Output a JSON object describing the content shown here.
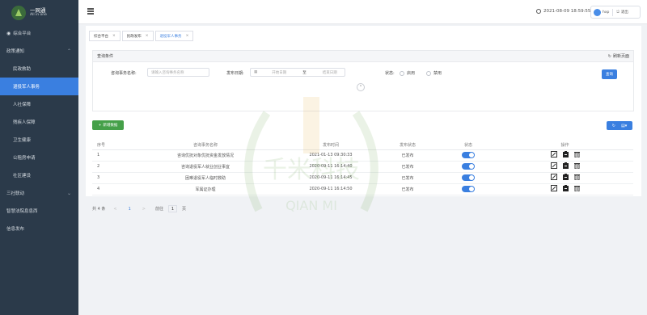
{
  "brand": {
    "title": "一网通",
    "subtitle": "All in one"
  },
  "sidebar": {
    "items": [
      {
        "label": "综合平台",
        "icon": "circle-icon"
      },
      {
        "label": "政策通知",
        "expanded": true
      },
      {
        "label": "民政救助"
      },
      {
        "label": "退役军人事务"
      },
      {
        "label": "人社保障"
      },
      {
        "label": "残疾人保障"
      },
      {
        "label": "卫生健康"
      },
      {
        "label": "公租房申请"
      },
      {
        "label": "社区建设"
      },
      {
        "label": "三社联动"
      },
      {
        "label": "智慧法院息息西"
      },
      {
        "label": "信息发布"
      }
    ]
  },
  "header": {
    "datetime": "2021-08-09 18:59:55",
    "user": "hxp",
    "logout": "退出"
  },
  "tabs": [
    {
      "label": "综合平台"
    },
    {
      "label": "民政发布"
    },
    {
      "label": "退役军人事务"
    }
  ],
  "query": {
    "title": "查询条件",
    "refresh": "刷新页面",
    "name_label": "咨询事务名称:",
    "name_placeholder": "请输入咨询事务名称",
    "date_label": "发布日期:",
    "date_start_placeholder": "开始日期",
    "date_to": "至",
    "date_end_placeholder": "结束日期",
    "status_label": "状态:",
    "status_enabled": "启用",
    "status_disabled": "禁用",
    "search": "查询"
  },
  "toolbar": {
    "add_label": "新增数据"
  },
  "table": {
    "headers": [
      "序号",
      "咨询事务名称",
      "发布时间",
      "发布状态",
      "状态",
      "操作"
    ],
    "rows": [
      {
        "no": "1",
        "name": "咨询优抚对象优抚资金发放情况",
        "time": "2021-01-13 09:30:33",
        "status": "已发布",
        "enabled": true
      },
      {
        "no": "2",
        "name": "咨询退役军人就业创业事宜",
        "time": "2020-09-11 16:14:40",
        "status": "已发布",
        "enabled": true
      },
      {
        "no": "3",
        "name": "困难退役军人临时救助",
        "time": "2020-09-11 16:14:45",
        "status": "已发布",
        "enabled": true
      },
      {
        "no": "4",
        "name": "军属证办理",
        "time": "2020-09-11 16:14:50",
        "status": "已发布",
        "enabled": true
      }
    ]
  },
  "pagination": {
    "total": "共 4 条",
    "prev": "<",
    "page": "1",
    "next": ">",
    "goto_label": "前往",
    "goto_value": "1",
    "page_unit": "页"
  },
  "watermark": {
    "text": "千米科技",
    "text_en": "QIAN MI"
  },
  "colors": {
    "sidebar": "#2b3a4a",
    "accent": "#3a7fe0",
    "add": "#45a049"
  }
}
